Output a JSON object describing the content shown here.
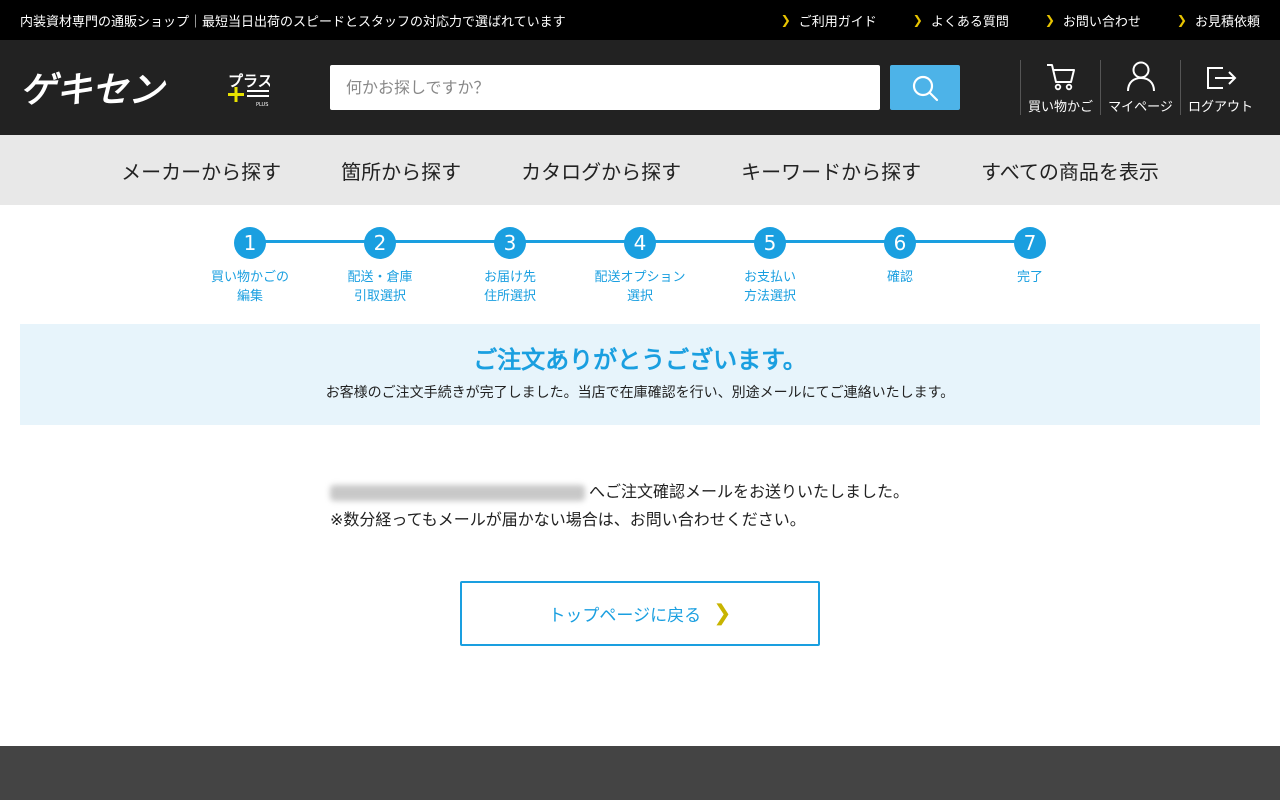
{
  "topbar": {
    "tagline": "内装資材専門の通販ショップ｜最短当日出荷のスピードとスタッフの対応力で選ばれています",
    "links": [
      "ご利用ガイド",
      "よくある質問",
      "お問い合わせ",
      "お見積依頼"
    ]
  },
  "header": {
    "logo_text": "ゲキセン",
    "logo_plus": "プラス",
    "logo_small": "PLUS",
    "search_placeholder": "何かお探しですか？",
    "cart_label": "買い物かご",
    "mypage_label": "マイページ",
    "logout_label": "ログアウト"
  },
  "nav": [
    "メーカーから探す",
    "箇所から探す",
    "カタログから探す",
    "キーワードから探す",
    "すべての商品を表示"
  ],
  "steps": [
    {
      "num": "1",
      "label": "買い物かごの\n編集"
    },
    {
      "num": "2",
      "label": "配送・倉庫\n引取選択"
    },
    {
      "num": "3",
      "label": "お届け先\n住所選択"
    },
    {
      "num": "4",
      "label": "配送オプション\n選択"
    },
    {
      "num": "5",
      "label": "お支払い\n方法選択"
    },
    {
      "num": "6",
      "label": "確認"
    },
    {
      "num": "7",
      "label": "完了"
    }
  ],
  "thanks": {
    "title": "ご注文ありがとうございます。",
    "text": "お客様のご注文手続きが完了しました。当店で在庫確認を行い、別途メールにてご連絡いたします。"
  },
  "message": {
    "line1": "へご注文確認メールをお送りいたしました。",
    "line2": "※数分経ってもメールが届かない場合は、お問い合わせください。"
  },
  "back_button": "トップページに戻る",
  "colors": {
    "accent": "#1a9fe0",
    "search_button": "#4db3e8",
    "header_bg": "#222222",
    "chevron": "#e8c400"
  }
}
